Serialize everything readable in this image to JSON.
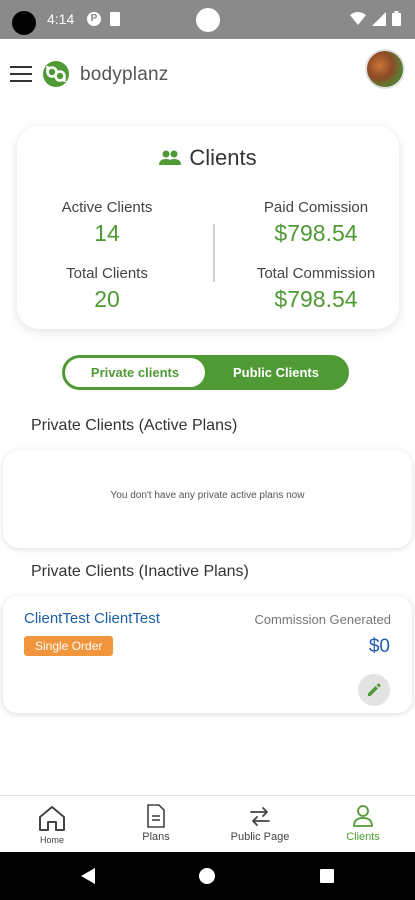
{
  "status_bar": {
    "time": "4:14",
    "p_badge": "P"
  },
  "header": {
    "brand_name": "bodyplanz"
  },
  "summary": {
    "title": "Clients",
    "active_clients_label": "Active Clients",
    "active_clients_value": "14",
    "total_clients_label": "Total Clients",
    "total_clients_value": "20",
    "paid_commission_label": "Paid Comission",
    "paid_commission_value": "$798.54",
    "total_commission_label": "Total Commission",
    "total_commission_value": "$798.54"
  },
  "toggle": {
    "private_label": "Private clients",
    "public_label": "Public Clients",
    "selected": "Private clients"
  },
  "active_section": {
    "title": "Private Clients (Active Plans)",
    "empty_message": "You don't have any private active plans now"
  },
  "inactive_section": {
    "title": "Private Clients (Inactive Plans)",
    "clients": [
      {
        "name": "ClientTest ClientTest",
        "badge": "Single Order",
        "commission_label": "Commission Generated",
        "commission_value": "$0"
      }
    ]
  },
  "bottom_nav": {
    "items": [
      {
        "label": "Home",
        "icon": "home-icon"
      },
      {
        "label": "Plans",
        "icon": "document-icon"
      },
      {
        "label": "Public Page",
        "icon": "swap-arrows-icon"
      },
      {
        "label": "Clients",
        "icon": "person-icon"
      }
    ],
    "active": "Clients"
  },
  "colors": {
    "brand_green": "#4f9a35",
    "link_blue": "#1f5ea8",
    "badge_orange": "#f0953b"
  }
}
